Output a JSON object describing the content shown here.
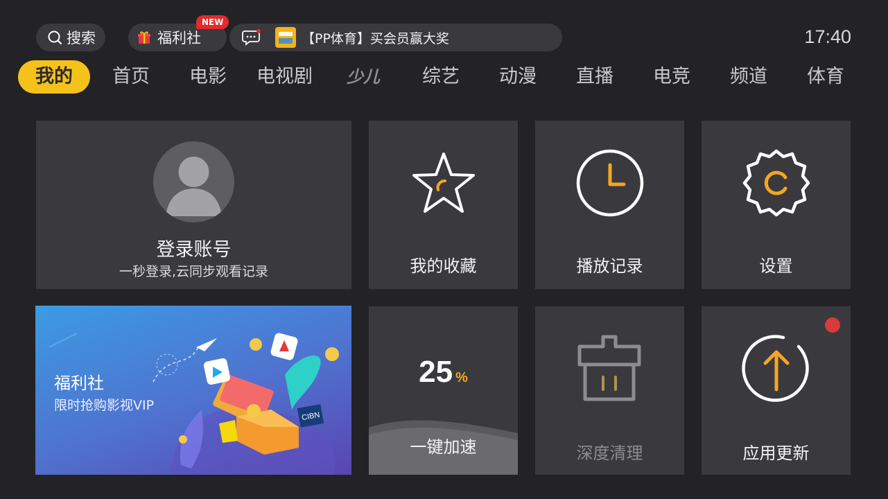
{
  "header": {
    "search_label": "搜索",
    "welfare_label": "福利社",
    "new_badge": "NEW",
    "notice_text": "【PP体育】买会员赢大奖",
    "clock": "17:40"
  },
  "tabs": [
    {
      "label": "我的",
      "active": true
    },
    {
      "label": "首页"
    },
    {
      "label": "电影"
    },
    {
      "label": "电视剧"
    },
    {
      "label": "少儿"
    },
    {
      "label": "综艺"
    },
    {
      "label": "动漫"
    },
    {
      "label": "直播"
    },
    {
      "label": "电竞"
    },
    {
      "label": "频道"
    },
    {
      "label": "体育"
    }
  ],
  "tiles": {
    "login": {
      "title": "登录账号",
      "subtitle": "一秒登录,云同步观看记录"
    },
    "favorites": {
      "title": "我的收藏"
    },
    "history": {
      "title": "播放记录"
    },
    "settings": {
      "title": "设置"
    },
    "welfare": {
      "title": "福利社",
      "subtitle": "限时抢购影视VIP"
    },
    "boost": {
      "percent": "25",
      "unit": "%",
      "title": "一键加速"
    },
    "clean": {
      "title": "深度清理"
    },
    "update": {
      "title": "应用更新"
    }
  },
  "colors": {
    "accent": "#f5c21b",
    "icon_accent": "#f5a623",
    "background": "#232226",
    "tile": "#3a393e",
    "badge_red": "#e32b2b"
  }
}
